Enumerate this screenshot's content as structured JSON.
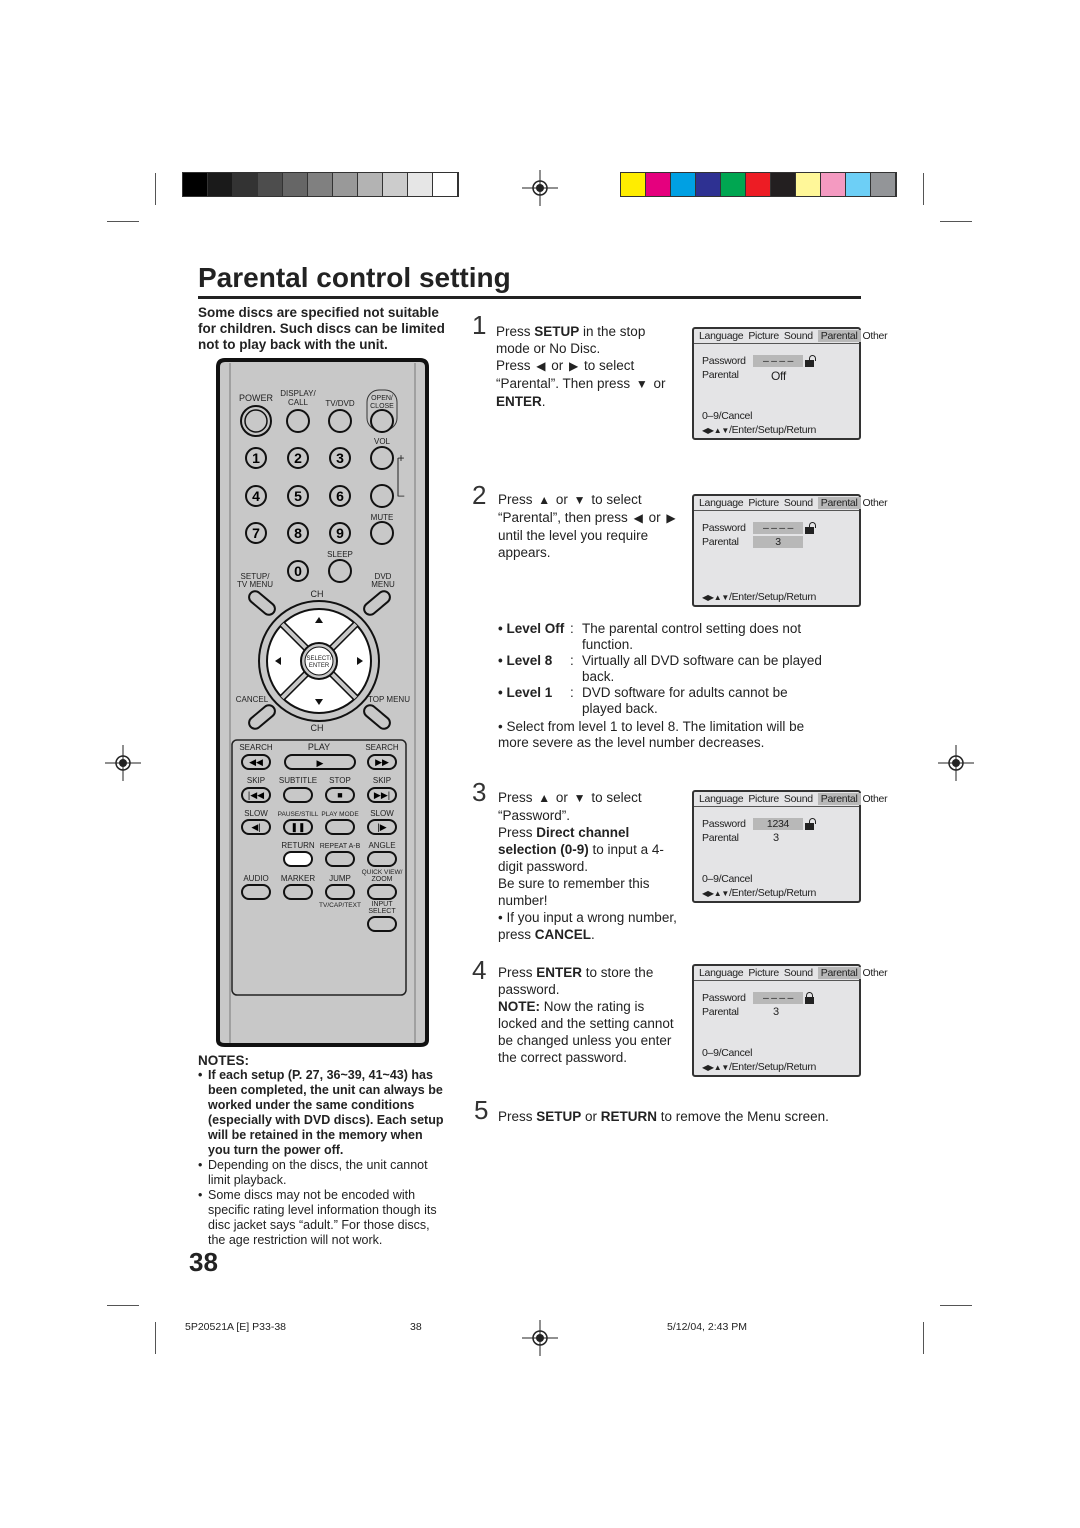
{
  "colors": {
    "grays": [
      "#000000",
      "#1a1a1a",
      "#333333",
      "#4d4d4d",
      "#666666",
      "#808080",
      "#999999",
      "#b3b3b3",
      "#cccccc",
      "#e6e6e6",
      "#ffffff"
    ],
    "process": [
      "#ffed00",
      "#e5007e",
      "#00a0e3",
      "#2e3192",
      "#00a651",
      "#ed1c24",
      "#231f20",
      "#fff799",
      "#f49ac1",
      "#6dcff6",
      "#939598"
    ],
    "remote_body": "#c8c8c8",
    "screen_bg": "#e4e4e6"
  },
  "title": "Parental control setting",
  "intro": "Some discs are specified not suitable for children. Such discs can be limited not to play back with the unit.",
  "steps": [
    {
      "num": "1",
      "segments": [
        {
          "t": "Press "
        },
        {
          "t": "SETUP",
          "b": 1
        },
        {
          "t": " in the stop mode or No Disc."
        },
        {
          "br": 1
        },
        {
          "t": "Press "
        },
        {
          "icon": "left"
        },
        {
          "t": " or "
        },
        {
          "icon": "right"
        },
        {
          "t": " to select “Parental”. Then press "
        },
        {
          "icon": "down"
        },
        {
          "t": " or "
        },
        {
          "t": "ENTER",
          "b": 1
        },
        {
          "t": "."
        }
      ]
    },
    {
      "num": "2",
      "segments": [
        {
          "t": "Press "
        },
        {
          "icon": "up"
        },
        {
          "t": " or "
        },
        {
          "icon": "down"
        },
        {
          "t": " to select “Parental”, then press "
        },
        {
          "icon": "left"
        },
        {
          "t": " or "
        },
        {
          "icon": "right"
        },
        {
          "t": " until the level you require appears."
        }
      ]
    },
    {
      "num": "3",
      "segments": [
        {
          "t": "Press "
        },
        {
          "icon": "up"
        },
        {
          "t": " or "
        },
        {
          "icon": "down"
        },
        {
          "t": " to select “Password”."
        },
        {
          "br": 1
        },
        {
          "t": "Press "
        },
        {
          "t": "Direct channel selection (0-9)",
          "b": 1
        },
        {
          "t": " to input a 4-digit  password."
        },
        {
          "br": 1
        },
        {
          "t": "Be sure to remember this number!"
        },
        {
          "br": 1
        },
        {
          "t": "• If you input a wrong number, press "
        },
        {
          "t": "CANCEL",
          "b": 1
        },
        {
          "t": "."
        }
      ]
    },
    {
      "num": "4",
      "segments": [
        {
          "t": "Press "
        },
        {
          "t": "ENTER",
          "b": 1
        },
        {
          "t": " to store the password."
        },
        {
          "br": 1
        },
        {
          "t": "NOTE:",
          "b": 1
        },
        {
          "t": " Now the rating is locked and the setting cannot be changed unless you enter the correct password."
        }
      ]
    },
    {
      "num": "5",
      "segments": [
        {
          "t": "Press "
        },
        {
          "t": "SETUP",
          "b": 1
        },
        {
          "t": " or "
        },
        {
          "t": "RETURN",
          "b": 1
        },
        {
          "t": " to remove the Menu screen."
        }
      ]
    }
  ],
  "screens": [
    {
      "tabs": [
        "Language",
        "Picture",
        "Sound",
        "Parental",
        "Other"
      ],
      "active_tab": "Parental",
      "password_label": "Password",
      "password": "– – – –",
      "parental_label": "Parental",
      "parental": "Off",
      "lock": "open",
      "hint1": "0–9/Cancel",
      "hint2": "/Enter/Setup/Return"
    },
    {
      "tabs": [
        "Language",
        "Picture",
        "Sound",
        "Parental",
        "Other"
      ],
      "active_tab": "Parental",
      "password_label": "Password",
      "password": "– – – –",
      "parental_label": "Parental",
      "parental": "3",
      "lock": "open",
      "hint1": "",
      "hint2": "/Enter/Setup/Return"
    },
    {
      "tabs": [
        "Language",
        "Picture",
        "Sound",
        "Parental",
        "Other"
      ],
      "active_tab": "Parental",
      "password_label": "Password",
      "password": "1234",
      "parental_label": "Parental",
      "parental": "3",
      "lock": "open",
      "hint1": "0–9/Cancel",
      "hint2": "/Enter/Setup/Return"
    },
    {
      "tabs": [
        "Language",
        "Picture",
        "Sound",
        "Parental",
        "Other"
      ],
      "active_tab": "Parental",
      "password_label": "Password",
      "password": "– – – –",
      "parental_label": "Parental",
      "parental": "3",
      "lock": "closed",
      "hint1": "0–9/Cancel",
      "hint2": "/Enter/Setup/Return"
    }
  ],
  "levels": [
    {
      "key": "• Level Off",
      "desc": "The parental control setting does not function."
    },
    {
      "key": "• Level 8",
      "desc": "Virtually all DVD software can be played back."
    },
    {
      "key": "• Level 1",
      "desc": "DVD software for adults cannot be played back."
    }
  ],
  "levels_note": "• Select from level 1 to level 8. The limitation will be more severe as the level number decreases.",
  "notes": {
    "title": "NOTES:",
    "items": [
      {
        "t": "If each setup (P. 27, 36~39, 41~43) has been completed, the unit can always be worked under the same conditions (especially with DVD discs). Each setup will be retained in the memory when you turn the power off.",
        "b": 1
      },
      {
        "t": "Depending on the discs, the unit cannot limit playback."
      },
      {
        "t": "Some discs may not be encoded with specific rating level information though its disc jacket says “adult.” For those discs, the age restriction will not work."
      }
    ]
  },
  "remote": {
    "labels": [
      "POWER",
      "DISPLAY/",
      "CALL",
      "TV/DVD",
      "OPEN/",
      "CLOSE",
      "VOL",
      "+",
      "–",
      "MUTE",
      "SLEEP",
      "SETUP/",
      "TV MENU",
      "DVD",
      "MENU",
      "CH",
      "CANCEL",
      "TOP MENU",
      "CH",
      "SELECT/",
      "ENTER",
      "SEARCH",
      "PLAY",
      "SEARCH",
      "SKIP",
      "SUBTITLE",
      "STOP",
      "SKIP",
      "SLOW",
      "PAUSE/STILL",
      "PLAY MODE",
      "SLOW",
      "RETURN",
      "REPEAT A-B",
      "ANGLE",
      "AUDIO",
      "MARKER",
      "JUMP",
      "QUICK VIEW/",
      "ZOOM",
      "TV/CAP/TEXT",
      "INPUT",
      "SELECT"
    ],
    "digits": [
      "1",
      "2",
      "3",
      "4",
      "5",
      "6",
      "7",
      "8",
      "9",
      "0"
    ]
  },
  "page_number": "38",
  "footer": {
    "code": "5P20521A [E] P33-38",
    "page": "38",
    "date": "5/12/04, 2:43 PM"
  }
}
